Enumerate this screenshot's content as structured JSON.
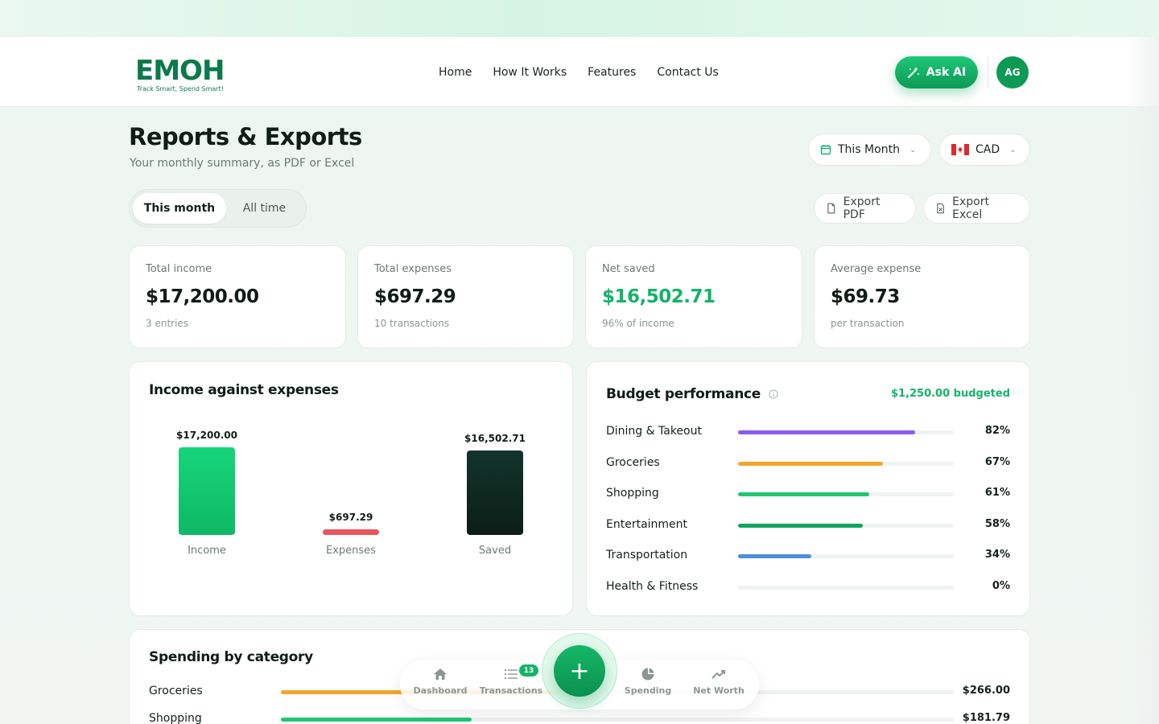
{
  "brand": {
    "logo_text": "EMOH",
    "tagline": "Track Smart, Spend Smart!"
  },
  "nav": {
    "links": [
      "Home",
      "How It Works",
      "Features",
      "Contact Us"
    ],
    "ask_ai_label": "Ask AI",
    "avatar_initials": "AG"
  },
  "page": {
    "title": "Reports & Exports",
    "subtitle": "Your monthly summary, as PDF or Excel",
    "period_select": "This Month",
    "currency_select": "CAD",
    "currency_flag": "🇨🇦",
    "tabs": [
      "This month",
      "All time"
    ],
    "export_pdf": "Export PDF",
    "export_excel": "Export Excel"
  },
  "stats": [
    {
      "label": "Total income",
      "value": "$17,200.00",
      "sub": "3 entries",
      "color": "#101c16"
    },
    {
      "label": "Total expenses",
      "value": "$697.29",
      "sub": "10 transactions",
      "color": "#101c16"
    },
    {
      "label": "Net saved",
      "value": "$16,502.71",
      "sub": "96% of income",
      "color": "#13b468"
    },
    {
      "label": "Average expense",
      "value": "$69.73",
      "sub": "per transaction",
      "color": "#101c16"
    }
  ],
  "income_vs_expenses": {
    "title": "Income against expenses",
    "chart_data": {
      "type": "bar",
      "categories": [
        "Income",
        "Expenses",
        "Saved"
      ],
      "values": [
        17200.0,
        697.29,
        16502.71
      ],
      "value_labels": [
        "$17,200.00",
        "$697.29",
        "$16,502.71"
      ],
      "colors": [
        "#13c270",
        "#e8555d",
        "#0f2a21"
      ]
    }
  },
  "budget": {
    "title": "Budget performance",
    "total": "$1,250.00 budgeted",
    "items": [
      {
        "name": "Dining & Takeout",
        "pct": 82,
        "label": "82%",
        "color": "#8a5cf0"
      },
      {
        "name": "Groceries",
        "pct": 67,
        "label": "67%",
        "color": "#f4a62a"
      },
      {
        "name": "Shopping",
        "pct": 61,
        "label": "61%",
        "color": "#22c772"
      },
      {
        "name": "Entertainment",
        "pct": 58,
        "label": "58%",
        "color": "#0fa65d"
      },
      {
        "name": "Transportation",
        "pct": 34,
        "label": "34%",
        "color": "#4a8fe0"
      },
      {
        "name": "Health & Fitness",
        "pct": 0,
        "label": "0%",
        "color": "#9aa5a0"
      }
    ]
  },
  "spending": {
    "title": "Spending by category",
    "items": [
      {
        "name": "Groceries",
        "amount": "$266.00",
        "value": 266.0,
        "color": "#f4a62a"
      },
      {
        "name": "Shopping",
        "amount": "$181.79",
        "value": 181.79,
        "color": "#22c772"
      }
    ]
  },
  "bottom_nav": {
    "items": [
      "Dashboard",
      "Transactions",
      "Spending",
      "Net Worth"
    ],
    "transactions_badge": "13",
    "fab_symbol": "+"
  }
}
